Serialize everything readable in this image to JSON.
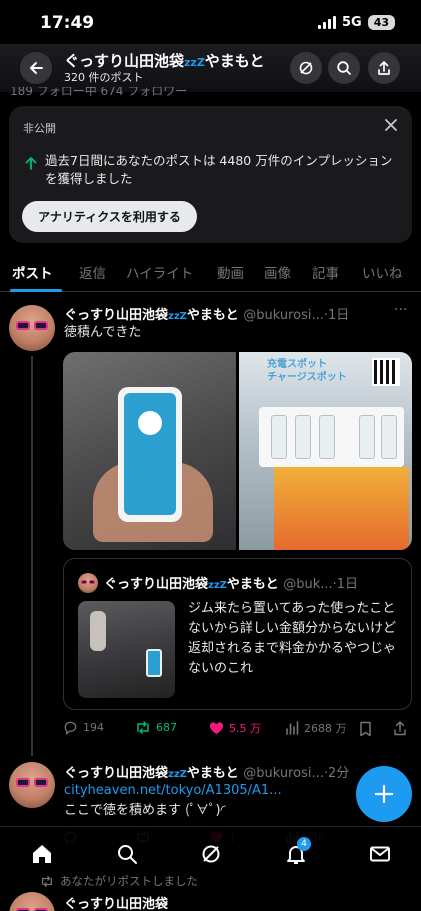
{
  "status_bar": {
    "time": "17:49",
    "network": "5G",
    "battery": "43"
  },
  "header": {
    "name": "ぐっすり山田池袋",
    "zzz": "zzZ",
    "name_suffix": "やまもと",
    "post_count": "320 件のポスト",
    "follow_strip": "189 フォロー中 674 フォロワー"
  },
  "private_card": {
    "label": "非公開",
    "message": "過去7日間にあなたのポストは 4480 万件のインプレッションを獲得しました",
    "button": "アナリティクスを利用する"
  },
  "tabs": [
    "ポスト",
    "返信",
    "ハイライト",
    "動画",
    "画像",
    "記事",
    "いいね"
  ],
  "post1": {
    "name": "ぐっすり山田池袋",
    "zzz": "zzZ",
    "name_suffix": "やまもと",
    "handle": "@bukurosi...",
    "time": "·1日",
    "text": "徳積んできた",
    "media_sign": "充電スポット\nチャージスポット",
    "quote": {
      "name": "ぐっすり山田池袋",
      "zzz": "zzZ",
      "name_suffix": "やまもと",
      "handle": "@buk...",
      "time": "·1日",
      "text": "ジム来たら置いてあった使ったことないから詳しい金額分からないけど返却されるまで料金かかるやつじゃないのこれ"
    },
    "actions": {
      "replies": "194",
      "reposts": "687",
      "likes": "5.5 万",
      "views": "2688 万"
    }
  },
  "post2": {
    "name": "ぐっすり山田池袋",
    "zzz": "zzZ",
    "name_suffix": "やまもと",
    "handle": "@bukurosi...",
    "time": "·2分",
    "link": "cityheaven.net/tokyo/A1305/A1...",
    "text": "ここで徳を積めます ͏(ﾟ∀ﾟ)◜",
    "actions": {
      "replies": "",
      "reposts": "",
      "likes": "1",
      "views": "236"
    }
  },
  "repost_note": "あなたがリポストしました",
  "post3_name": "ぐっすり山田池袋",
  "bottom_nav": {
    "notifications_badge": "4"
  },
  "colors": {
    "accent": "#1d9bf0",
    "like": "#f91880",
    "repost": "#00ba7c",
    "muted": "#71767b"
  }
}
